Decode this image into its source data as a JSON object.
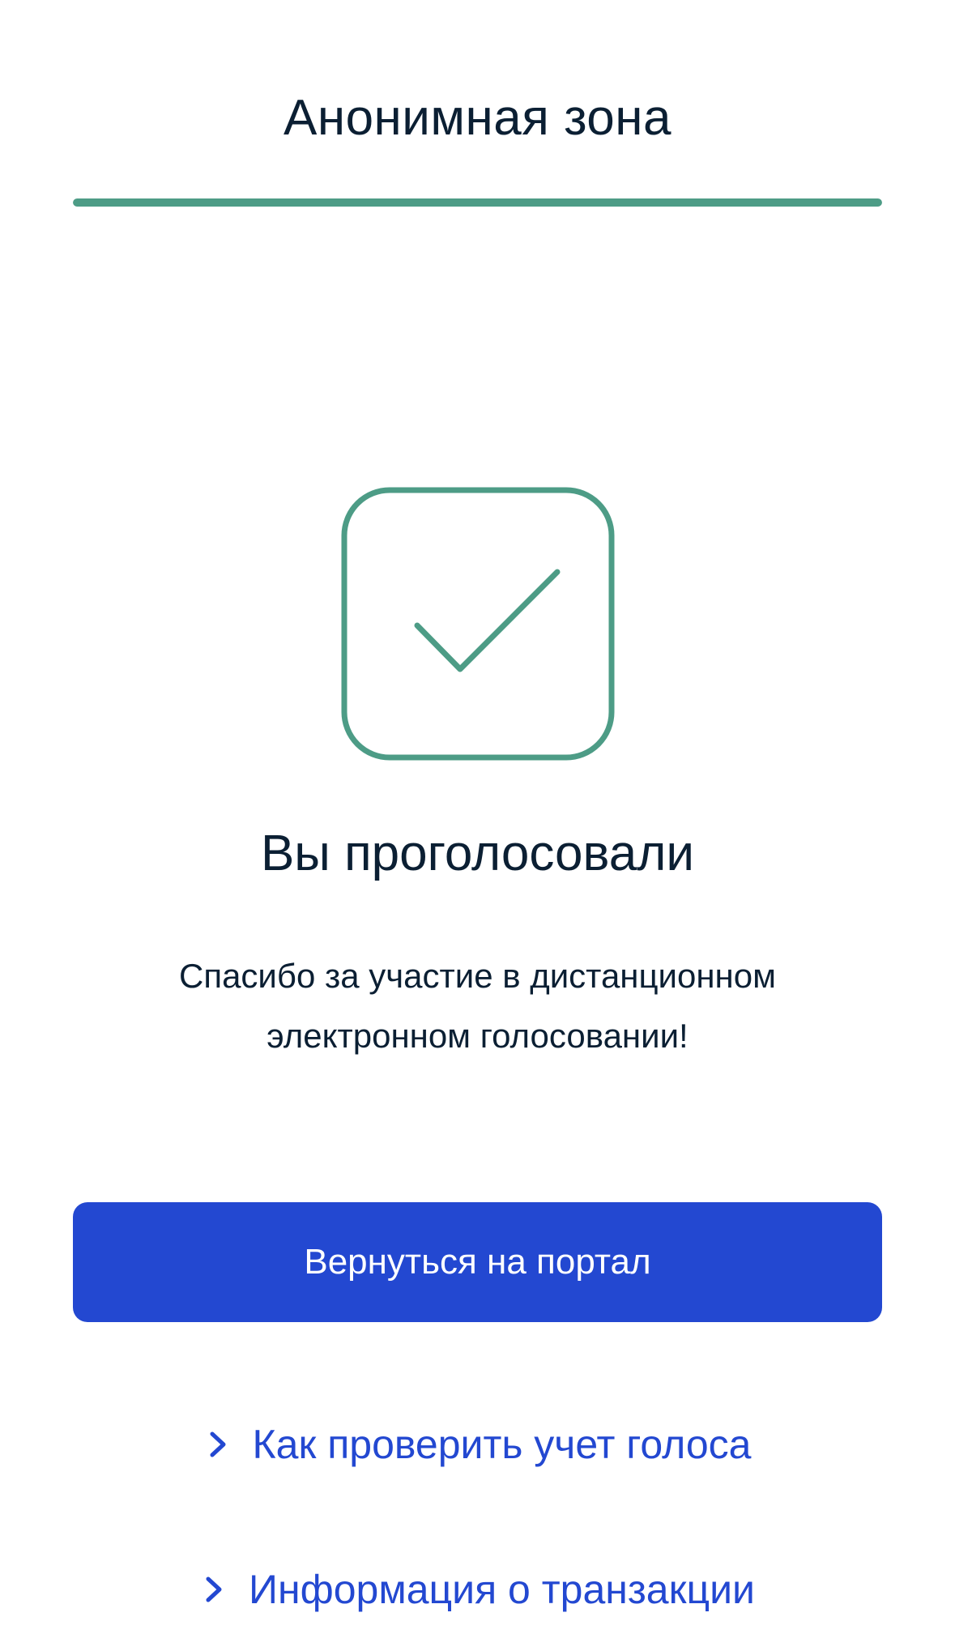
{
  "header": {
    "title": "Анонимная зона",
    "progress_fraction": 1.0
  },
  "status": {
    "icon": "checkmark-icon",
    "title": "Вы проголосовали",
    "message": "Спасибо за участие в дистанционном электронном голосовании!"
  },
  "actions": {
    "return_button_label": "Вернуться на портал",
    "links": [
      {
        "icon": "chevron-right-icon",
        "label": "Как проверить учет голоса"
      },
      {
        "icon": "chevron-right-icon",
        "label": "Информация о транзакции"
      }
    ]
  },
  "colors": {
    "accent_green": "#4d9c86",
    "primary_blue": "#2348d1",
    "text_dark": "#0b1f33"
  }
}
